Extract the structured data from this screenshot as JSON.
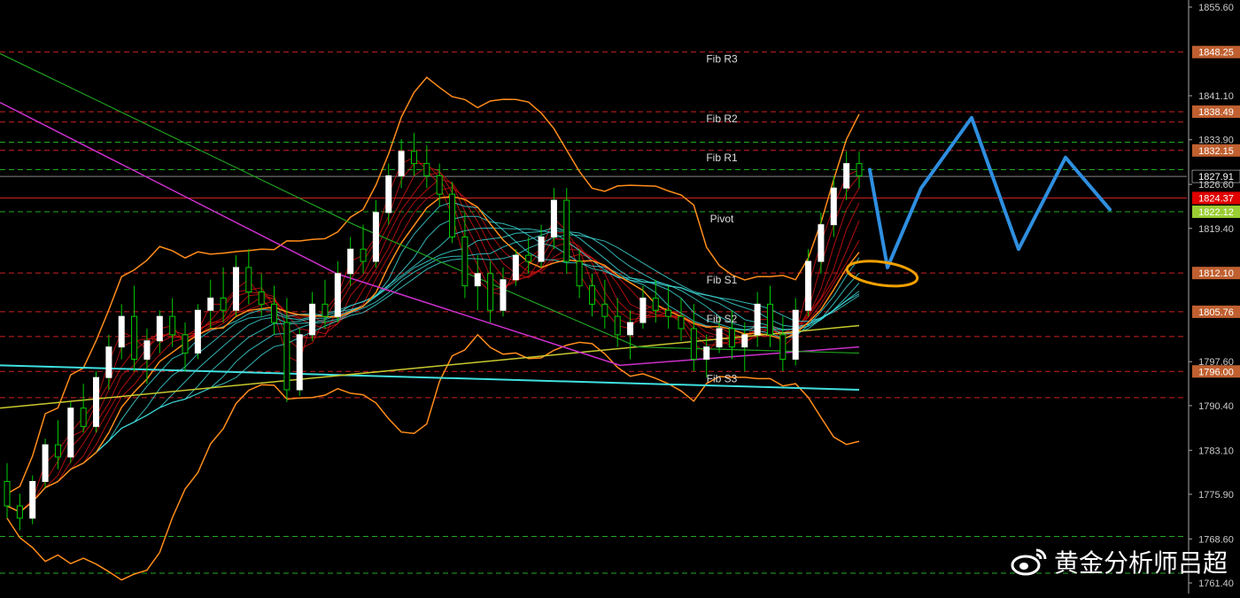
{
  "chart_data": {
    "type": "candlestick",
    "price_range": [
      1762.0,
      1855.0
    ],
    "axis_ticks": [
      "1841.10",
      "1833.90",
      "1826.60",
      "1819.40",
      "1812.10",
      "1804.90",
      "1797.60",
      "1790.40",
      "1783.10",
      "1775.90",
      "1768.60",
      "1761.40",
      "1855.60"
    ],
    "fib_levels": [
      {
        "name": "Fib R3",
        "price": 1848.25,
        "label": "1848.25",
        "color": "#c06030"
      },
      {
        "name": "Fib R2",
        "price": 1838.49,
        "label": "1838.49",
        "color": "#c06030"
      },
      {
        "name": "Fib R1",
        "price": 1832.15,
        "label": "1832.15",
        "color": "#c06030"
      },
      {
        "name": "Pivot",
        "price": 1822.12,
        "label": "1822.12",
        "color": "#9acd32"
      },
      {
        "name": "Fib S1",
        "price": 1812.1,
        "label": "1812.10",
        "color": "#c06030"
      },
      {
        "name": "Fib S2",
        "price": 1805.76,
        "label": "1805.76",
        "color": "#c06030"
      },
      {
        "name": "Fib S3",
        "price": 1796.0,
        "label": "1796.00",
        "color": "#c06030"
      }
    ],
    "current_price": {
      "price": 1827.91,
      "label": "1827.91"
    },
    "bid_price": {
      "price": 1824.37,
      "label": "1824.37",
      "color": "#e00000"
    },
    "colors": {
      "bull": "#ffffff",
      "bear": "#00cc00",
      "bollinger": "#ff8c1a",
      "ma_cyan": "#40e0e0",
      "ma_red": "#cc1010",
      "ma_magenta": "#cc30cc",
      "ma_yellow": "#c8c830",
      "ma_green": "#20a020",
      "forecast": "#2f8fe0",
      "highlight": "#f0a000",
      "grid": "#cc2222",
      "grid_green": "#22aa22"
    },
    "candles": [
      [
        1778,
        1781,
        1772,
        1774
      ],
      [
        1774,
        1776,
        1770,
        1772
      ],
      [
        1772,
        1779,
        1771,
        1778
      ],
      [
        1778,
        1785,
        1777,
        1784
      ],
      [
        1784,
        1788,
        1780,
        1782
      ],
      [
        1782,
        1791,
        1781,
        1790
      ],
      [
        1790,
        1794,
        1786,
        1787
      ],
      [
        1787,
        1796,
        1786,
        1795
      ],
      [
        1795,
        1802,
        1793,
        1800
      ],
      [
        1800,
        1807,
        1798,
        1805
      ],
      [
        1805,
        1810,
        1796,
        1798
      ],
      [
        1798,
        1803,
        1794,
        1801
      ],
      [
        1801,
        1806,
        1799,
        1805
      ],
      [
        1805,
        1808,
        1800,
        1802
      ],
      [
        1802,
        1804,
        1796,
        1799
      ],
      [
        1799,
        1807,
        1798,
        1806
      ],
      [
        1806,
        1811,
        1803,
        1808
      ],
      [
        1808,
        1813,
        1804,
        1806
      ],
      [
        1806,
        1815,
        1805,
        1813
      ],
      [
        1813,
        1816,
        1807,
        1809
      ],
      [
        1809,
        1812,
        1805,
        1807
      ],
      [
        1807,
        1810,
        1802,
        1804
      ],
      [
        1804,
        1808,
        1791,
        1793
      ],
      [
        1793,
        1803,
        1792,
        1802
      ],
      [
        1802,
        1809,
        1801,
        1807
      ],
      [
        1807,
        1811,
        1803,
        1805
      ],
      [
        1805,
        1814,
        1804,
        1812
      ],
      [
        1812,
        1818,
        1810,
        1816
      ],
      [
        1816,
        1820,
        1812,
        1814
      ],
      [
        1814,
        1824,
        1813,
        1822
      ],
      [
        1822,
        1830,
        1820,
        1828
      ],
      [
        1828,
        1834,
        1826,
        1832
      ],
      [
        1832,
        1835,
        1828,
        1830
      ],
      [
        1830,
        1833,
        1826,
        1828
      ],
      [
        1828,
        1830,
        1823,
        1825
      ],
      [
        1825,
        1827,
        1817,
        1818
      ],
      [
        1818,
        1822,
        1808,
        1810
      ],
      [
        1810,
        1815,
        1806,
        1812
      ],
      [
        1812,
        1814,
        1804,
        1806
      ],
      [
        1806,
        1813,
        1805,
        1811
      ],
      [
        1811,
        1816,
        1810,
        1815
      ],
      [
        1815,
        1818,
        1812,
        1814
      ],
      [
        1814,
        1820,
        1813,
        1818
      ],
      [
        1818,
        1826,
        1816,
        1824
      ],
      [
        1824,
        1826,
        1812,
        1814
      ],
      [
        1814,
        1816,
        1808,
        1810
      ],
      [
        1810,
        1812,
        1805,
        1807
      ],
      [
        1807,
        1811,
        1803,
        1805
      ],
      [
        1805,
        1808,
        1800,
        1802
      ],
      [
        1802,
        1806,
        1798,
        1804
      ],
      [
        1804,
        1810,
        1803,
        1808
      ],
      [
        1808,
        1811,
        1804,
        1806
      ],
      [
        1806,
        1810,
        1803,
        1805
      ],
      [
        1805,
        1808,
        1801,
        1803
      ],
      [
        1803,
        1807,
        1796,
        1798
      ],
      [
        1798,
        1802,
        1795,
        1800
      ],
      [
        1800,
        1805,
        1799,
        1803
      ],
      [
        1803,
        1806,
        1798,
        1800
      ],
      [
        1800,
        1804,
        1796,
        1802
      ],
      [
        1802,
        1809,
        1800,
        1807
      ],
      [
        1807,
        1810,
        1800,
        1802
      ],
      [
        1802,
        1805,
        1796,
        1798
      ],
      [
        1798,
        1808,
        1797,
        1806
      ],
      [
        1806,
        1816,
        1805,
        1814
      ],
      [
        1814,
        1822,
        1812,
        1820
      ],
      [
        1820,
        1828,
        1818,
        1826
      ],
      [
        1826,
        1832,
        1824,
        1830
      ],
      [
        1830,
        1832,
        1826,
        1828
      ]
    ]
  },
  "watermark": {
    "text": "黄金分析师吕超",
    "icon": "weibo-icon"
  }
}
